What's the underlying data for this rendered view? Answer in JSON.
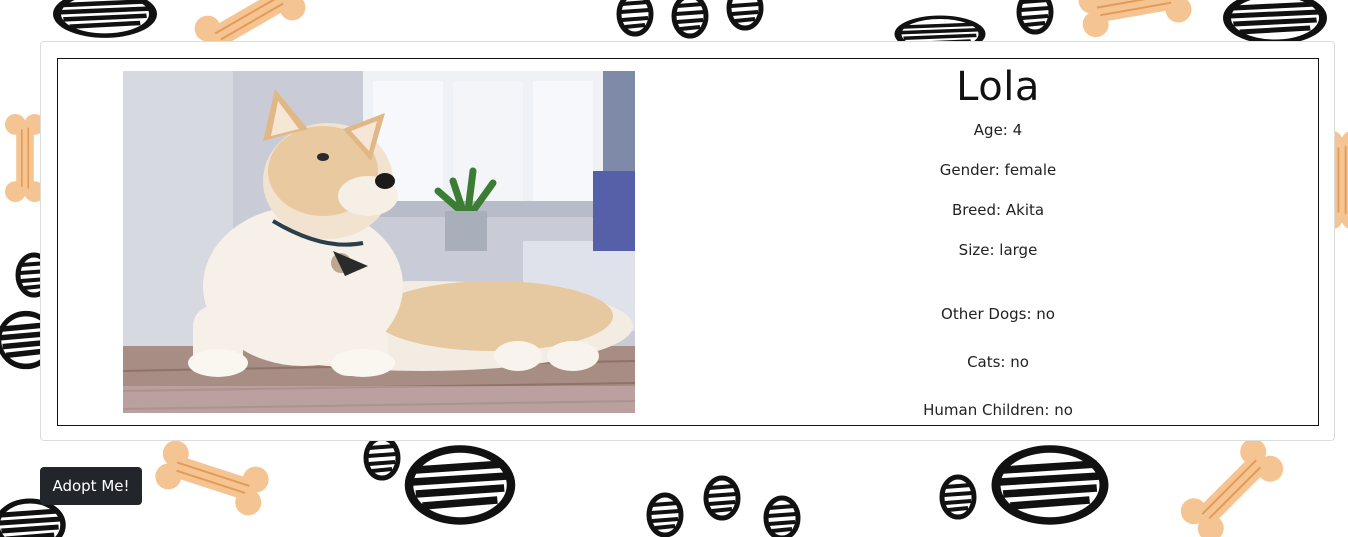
{
  "pet": {
    "name": "Lola",
    "age": "Age: 4",
    "gender": "Gender: female",
    "breed": "Breed: Akita",
    "size": "Size: large",
    "other_dogs": "Other Dogs: no",
    "cats": "Cats: no",
    "human_children": "Human Children: no"
  },
  "actions": {
    "adopt_label": "Adopt Me!"
  },
  "colors": {
    "paw": "#111111",
    "bone": "#f5c493",
    "button_bg": "#22252a"
  },
  "icons": {
    "background_paw": "paw-print-icon",
    "background_bone": "bone-icon"
  }
}
